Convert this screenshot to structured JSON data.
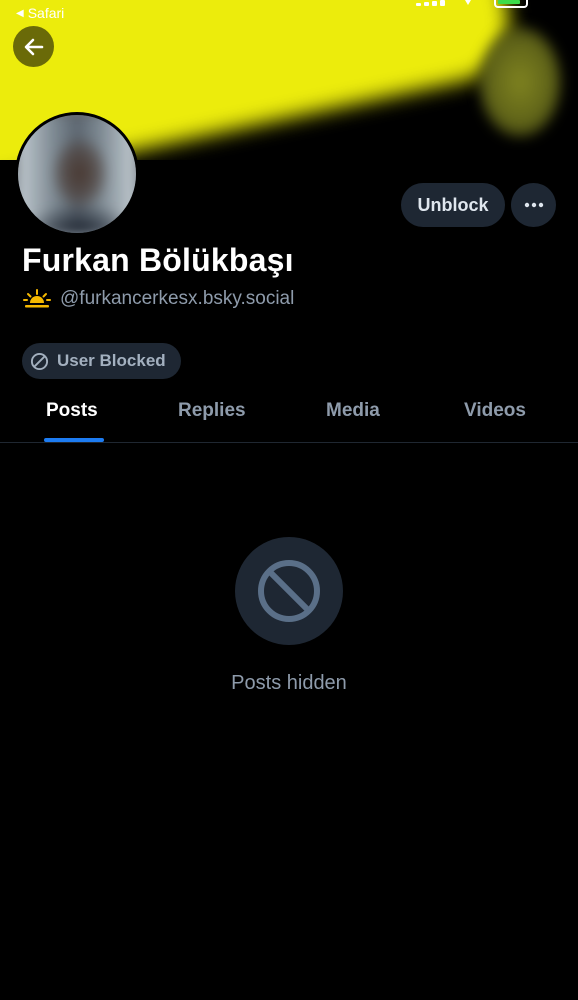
{
  "status_bar": {
    "back_app_label": "Safari",
    "battery_color": "#3ddc4a"
  },
  "banner": {
    "accent_color": "#ecec0c"
  },
  "header": {
    "back_icon": "arrow-left-icon"
  },
  "profile": {
    "display_name": "Furkan Bölükbaşı",
    "handle": "@furkancerkesx.bsky.social",
    "handle_emoji_icon": "sunrise-icon",
    "avatar": "avatar-photo"
  },
  "actions": {
    "unblock_label": "Unblock",
    "more_icon": "ellipsis-icon"
  },
  "blocked_badge": {
    "label": "User Blocked",
    "icon": "block-icon"
  },
  "tabs": [
    {
      "label": "Posts",
      "active": true
    },
    {
      "label": "Replies",
      "active": false
    },
    {
      "label": "Media",
      "active": false
    },
    {
      "label": "Videos",
      "active": false
    }
  ],
  "empty_state": {
    "icon": "block-icon",
    "message": "Posts hidden"
  },
  "colors": {
    "background": "#000000",
    "surface": "#1e2733",
    "muted_text": "#8e9bab",
    "active_tab_indicator": "#1d7cf2"
  }
}
